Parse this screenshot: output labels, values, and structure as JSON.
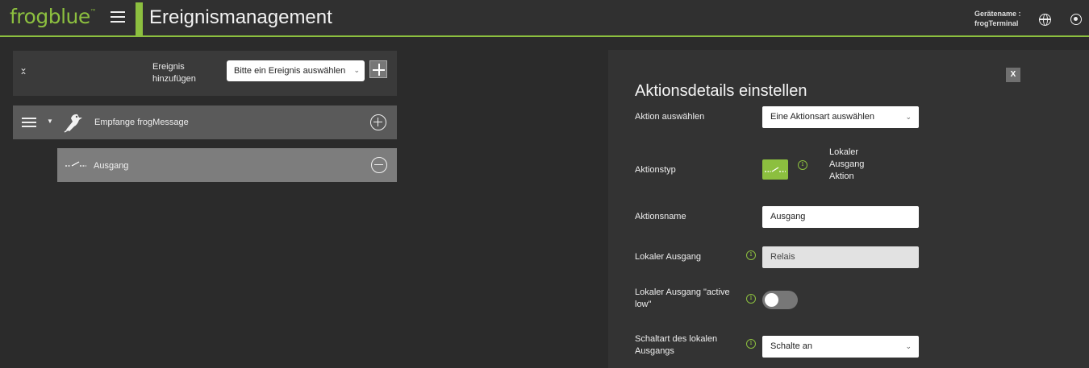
{
  "header": {
    "logo": "frogblue",
    "logo_mark": "™",
    "title": "Ereignismanagement",
    "device_label": "Gerätename :",
    "device_name": "frogTerminal"
  },
  "event_bar": {
    "add_label_line1": "Ereignis",
    "add_label_line2": "hinzufügen",
    "select_value": "Bitte ein Ereignis auswählen"
  },
  "events": [
    {
      "name": "Empfange frogMessage",
      "actions": [
        {
          "name": "Ausgang"
        }
      ]
    }
  ],
  "panel": {
    "title": "Aktionsdetails einstellen",
    "close_label": "X",
    "select_action_label": "Aktion auswählen",
    "select_action_value": "Eine Aktionsart auswählen",
    "type_label": "Aktionstyp",
    "type_text_1": "Lokaler",
    "type_text_2": "Ausgang",
    "type_text_3": "Aktion",
    "name_label": "Aktionsname",
    "name_value": "Ausgang",
    "output_label": "Lokaler Ausgang",
    "output_value": "Relais",
    "active_low_label": "Lokaler Ausgang \"active low\"",
    "active_low_on": false,
    "switch_mode_label": "Schaltart des lokalen Ausgangs",
    "switch_mode_value": "Schalte an"
  },
  "colors": {
    "accent": "#8cbf3f",
    "background": "#2b2b2b"
  }
}
